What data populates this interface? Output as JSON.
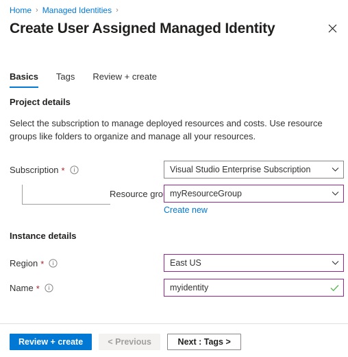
{
  "breadcrumb": {
    "items": [
      {
        "label": "Home"
      },
      {
        "label": "Managed Identities"
      }
    ],
    "separator": "›"
  },
  "header": {
    "title": "Create User Assigned Managed Identity",
    "close_icon": "close-icon"
  },
  "tabs": [
    {
      "label": "Basics",
      "active": true
    },
    {
      "label": "Tags",
      "active": false
    },
    {
      "label": "Review + create",
      "active": false
    }
  ],
  "project_details": {
    "heading": "Project details",
    "description": "Select the subscription to manage deployed resources and costs. Use resource groups like folders to organize and manage all your resources.",
    "subscription": {
      "label": "Subscription",
      "required": "*",
      "value": "Visual Studio Enterprise Subscription",
      "info_icon": "info-icon",
      "chevron_icon": "chevron-down-icon"
    },
    "resource_group": {
      "label": "Resource group",
      "required": "*",
      "value": "myResourceGroup",
      "info_icon": "info-icon",
      "chevron_icon": "chevron-down-icon",
      "create_new_label": "Create new"
    }
  },
  "instance_details": {
    "heading": "Instance details",
    "region": {
      "label": "Region",
      "required": "*",
      "value": "East US",
      "info_icon": "info-icon",
      "chevron_icon": "chevron-down-icon"
    },
    "name": {
      "label": "Name",
      "required": "*",
      "value": "myidentity",
      "placeholder": "",
      "info_icon": "info-icon",
      "valid_icon": "checkmark-icon"
    }
  },
  "footer": {
    "review_create_label": "Review + create",
    "previous_label": "< Previous",
    "next_label": "Next : Tags >"
  },
  "colors": {
    "accent": "#0078d4",
    "required_star": "#a4262c",
    "focus_border": "#93278f",
    "default_border": "#8a8886",
    "valid_check": "#5cb85c"
  }
}
